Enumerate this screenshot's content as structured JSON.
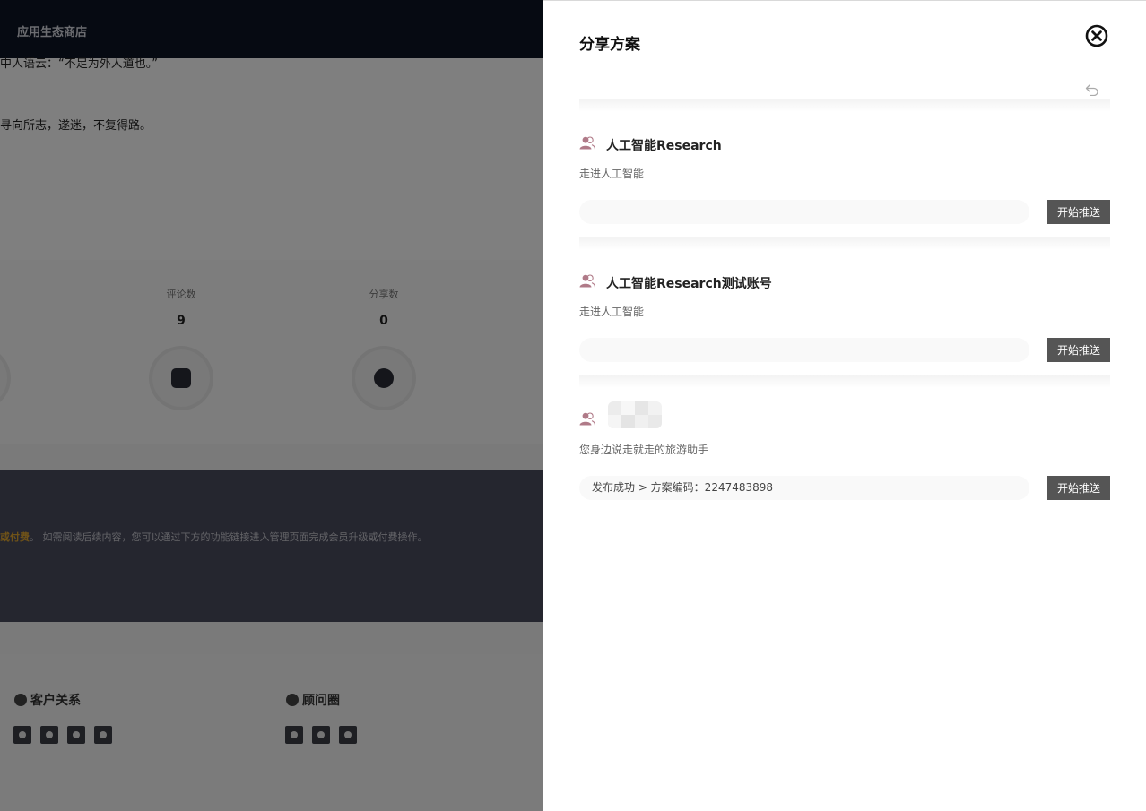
{
  "background": {
    "nav_title": "应用生态商店",
    "article_lines": [
      "中人语云：“不足为外人道也。”",
      "寻向所志，遂迷，不复得路。"
    ],
    "stats": [
      {
        "label": "评论数",
        "value": "9",
        "icon": "edit-icon"
      },
      {
        "label": "分享数",
        "value": "0",
        "icon": "share-icon"
      }
    ],
    "member_notice_highlight": "或付费",
    "member_notice_sep": "。",
    "member_notice_text": "如需阅读后续内容，您可以通过下方的功能链接进入管理页面完成会员升级或付费操作。",
    "footer_groups": [
      {
        "title": "客户关系",
        "icons": [
          "add-user-icon",
          "headset-icon",
          "handshake-icon",
          "help-icon"
        ]
      },
      {
        "title": "顾问圈",
        "icons": [
          "add-user-icon",
          "headset-icon",
          "shield-icon"
        ]
      }
    ]
  },
  "drawer": {
    "title": "分享方案",
    "close_icon": "close-circle-icon",
    "undo_icon": "undo-icon",
    "push_label": "开始推送",
    "accounts": [
      {
        "name": "人工智能Research",
        "desc": "走进人工智能",
        "status": "",
        "blurred": false
      },
      {
        "name": "人工智能Research测试账号",
        "desc": "走进人工智能",
        "status": "",
        "blurred": false
      },
      {
        "name": "",
        "desc": "您身边说走就走的旅游助手",
        "status": "发布成功 > 方案编码：2247483898",
        "blurred": true
      }
    ]
  },
  "colors": {
    "nav_bg": "#0d1424",
    "member_bg": "#4a4c5e",
    "highlight": "#e0a630",
    "push_button": "#555555",
    "user_icon": "#b07a88"
  }
}
